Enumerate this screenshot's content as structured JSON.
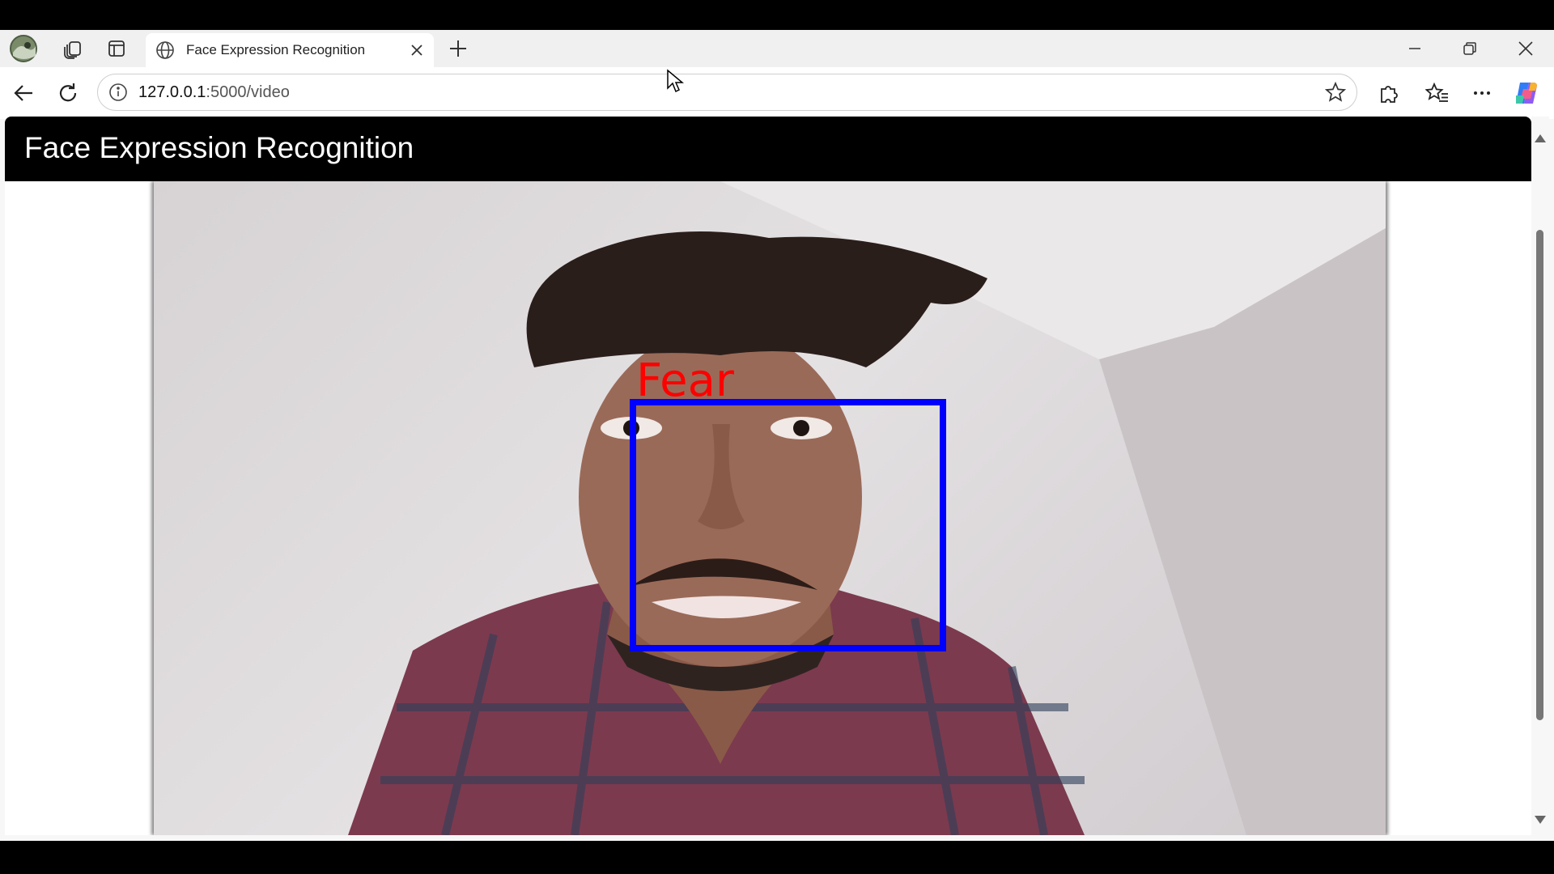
{
  "browser": {
    "tab": {
      "title": "Face Expression Recognition"
    },
    "address": {
      "host": "127.0.0.1",
      "path": ":5000/video"
    }
  },
  "page": {
    "header_title": "Face Expression Recognition"
  },
  "video": {
    "detection_label": "Fear",
    "label_color": "#ff0000",
    "box_color": "#0000ff"
  },
  "icons": {
    "profile": "profile-icon",
    "collections": "collections-icon",
    "tab_actions": "tab-actions-icon",
    "tab_favicon": "globe-icon",
    "tab_close": "close-icon",
    "new_tab": "plus-icon",
    "minimize": "minimize-icon",
    "restore": "restore-icon",
    "close_window": "close-icon",
    "back": "back-arrow-icon",
    "refresh": "refresh-icon",
    "site_info": "info-icon",
    "favorite": "star-icon",
    "extensions": "puzzle-icon",
    "favorites": "favorites-icon",
    "more": "more-icon",
    "copilot": "copilot-icon",
    "cursor": "mouse-cursor-icon"
  }
}
